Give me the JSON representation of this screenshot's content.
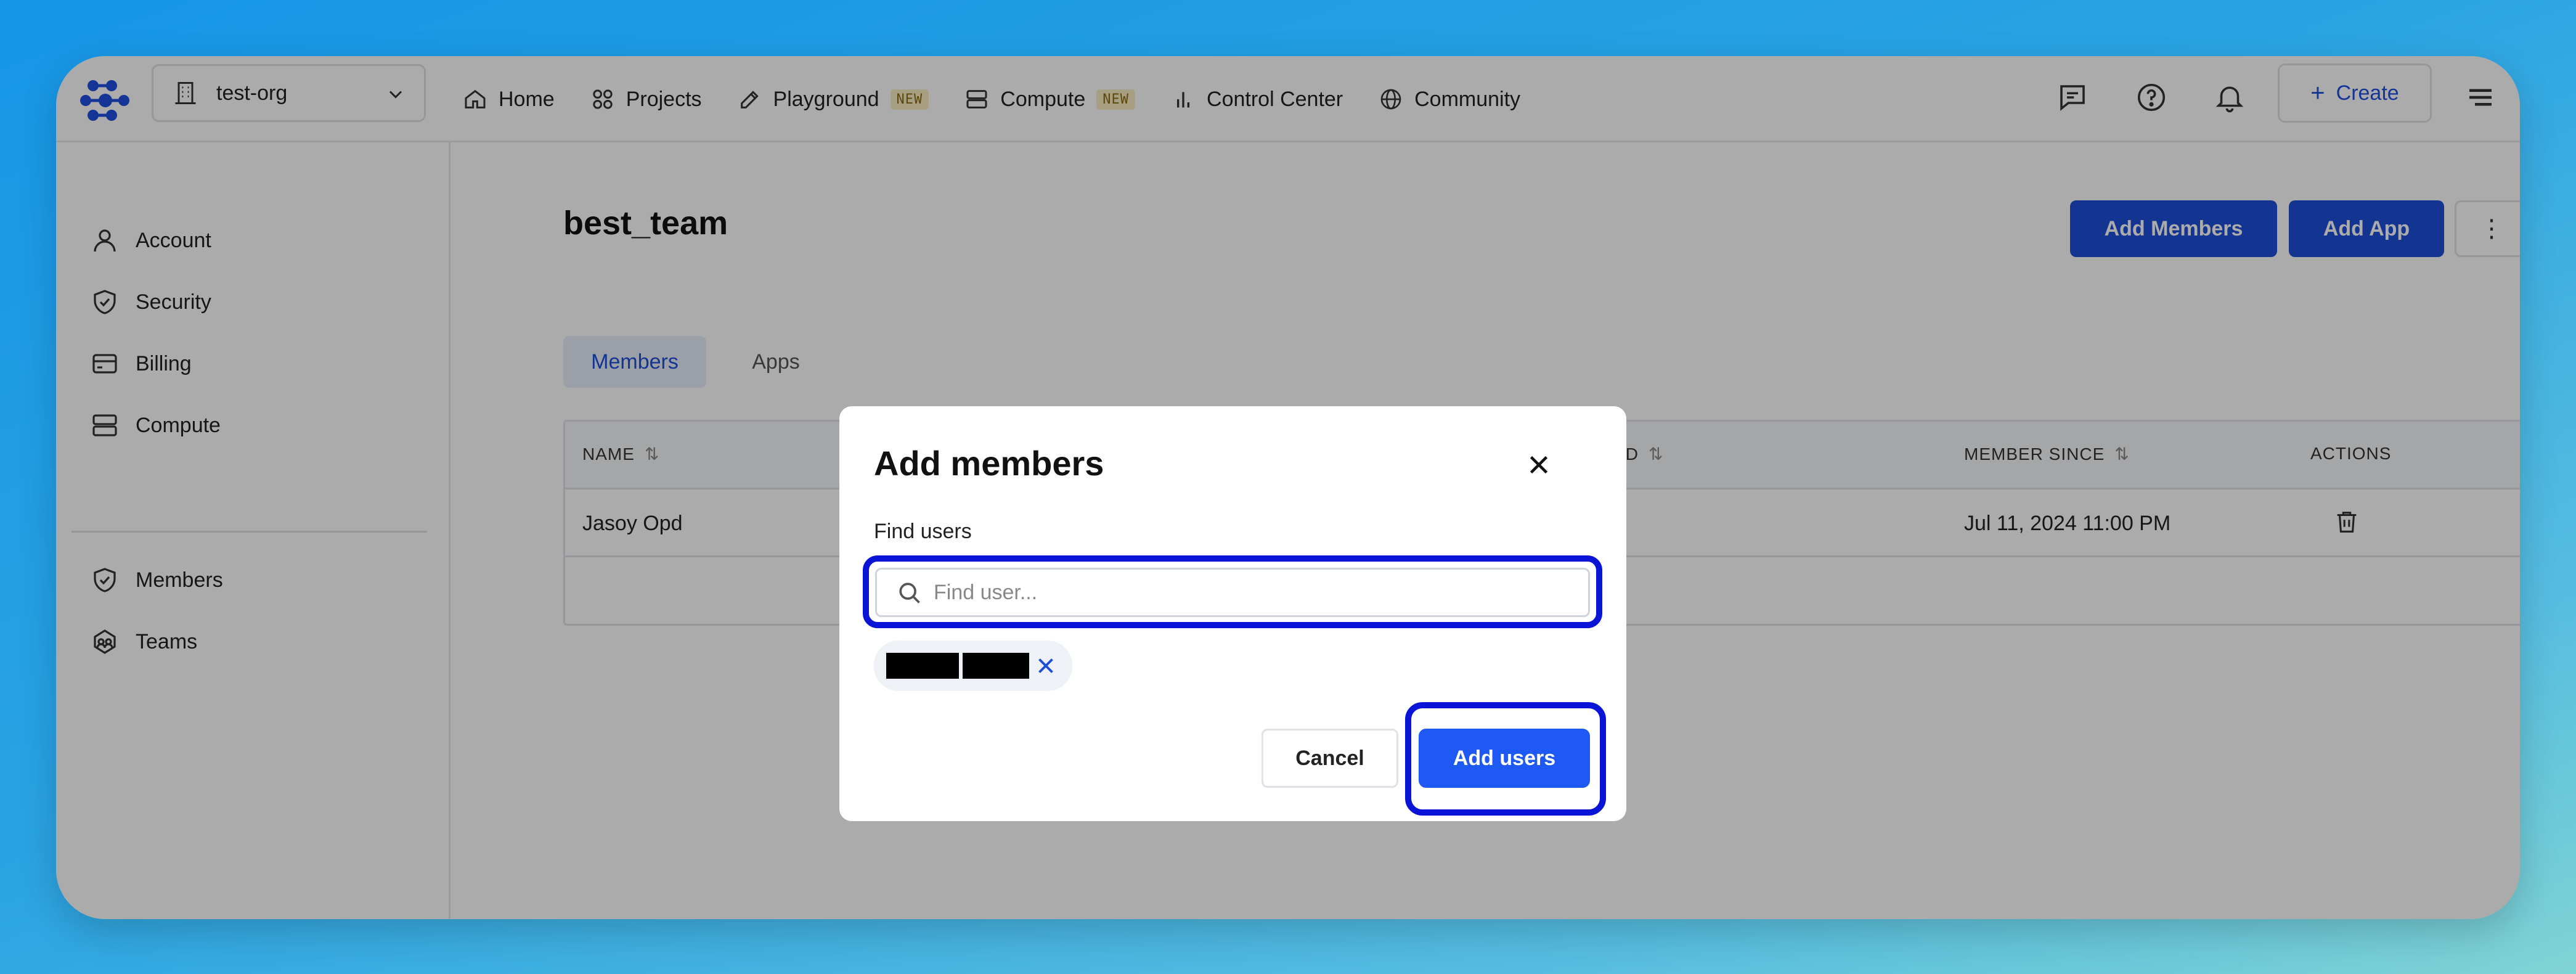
{
  "header": {
    "org_name": "test-org",
    "nav": [
      {
        "label": "Home",
        "icon": "home-icon"
      },
      {
        "label": "Projects",
        "icon": "grid-icon"
      },
      {
        "label": "Playground",
        "icon": "pen-icon",
        "badge": "NEW"
      },
      {
        "label": "Compute",
        "icon": "server-icon",
        "badge": "NEW"
      },
      {
        "label": "Control Center",
        "icon": "bar-chart-icon"
      },
      {
        "label": "Community",
        "icon": "globe-icon"
      }
    ],
    "create_label": "Create"
  },
  "sidebar": {
    "items": [
      {
        "label": "Account",
        "icon": "user-icon"
      },
      {
        "label": "Security",
        "icon": "shield-check-icon"
      },
      {
        "label": "Billing",
        "icon": "credit-card-icon"
      },
      {
        "label": "Compute",
        "icon": "server-icon"
      },
      {
        "label": "Members",
        "icon": "shield-check-icon"
      },
      {
        "label": "Teams",
        "icon": "team-icon"
      }
    ]
  },
  "main": {
    "title": "best_team",
    "add_members_label": "Add Members",
    "add_app_label": "Add App",
    "more_label": "⋮",
    "tabs": [
      {
        "label": "Members",
        "active": true
      },
      {
        "label": "Apps",
        "active": false
      }
    ],
    "table": {
      "headers": [
        "NAME",
        "ID",
        "MEMBER SINCE",
        "ACTIONS"
      ],
      "rows": [
        {
          "name": "Jasoy Opd",
          "member_since": "Jul 11, 2024 11:00 PM"
        }
      ]
    }
  },
  "modal": {
    "title": "Add members",
    "find_label": "Find users",
    "search_placeholder": "Find user...",
    "cancel_label": "Cancel",
    "add_label": "Add users"
  },
  "colors": {
    "accent": "#1d4ed8",
    "highlight": "#0a14d6",
    "badge_bg": "#fbeec4"
  }
}
